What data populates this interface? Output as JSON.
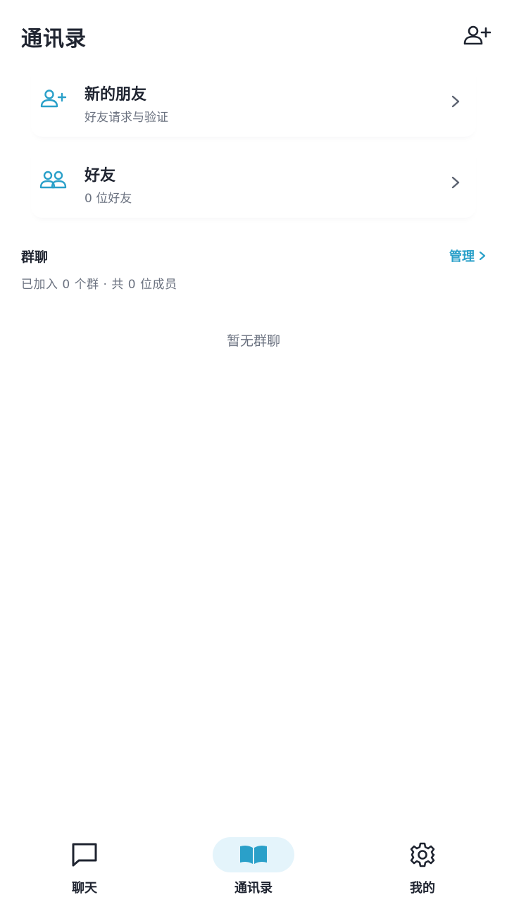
{
  "header": {
    "title": "通讯录",
    "add_icon": "person-add-icon"
  },
  "cards": {
    "new_friends": {
      "title": "新的朋友",
      "subtitle": "好友请求与验证",
      "icon": "person-add-icon"
    },
    "friends": {
      "title": "好友",
      "subtitle": "0 位好友",
      "icon": "people-icon"
    }
  },
  "groups": {
    "title": "群聊",
    "manage_label": "管理",
    "stats": "已加入 0 个群 · 共 0 位成员",
    "empty_text": "暂无群聊"
  },
  "bottom_nav": {
    "items": [
      {
        "label": "聊天",
        "icon": "chat-bubble-icon",
        "active": false
      },
      {
        "label": "通讯录",
        "icon": "book-icon",
        "active": true
      },
      {
        "label": "我的",
        "icon": "gear-icon",
        "active": false
      }
    ]
  },
  "colors": {
    "accent": "#2aa0c9",
    "text_primary": "#1f2430",
    "text_secondary": "#6b7280",
    "active_nav_bg": "#e4f4fb"
  }
}
